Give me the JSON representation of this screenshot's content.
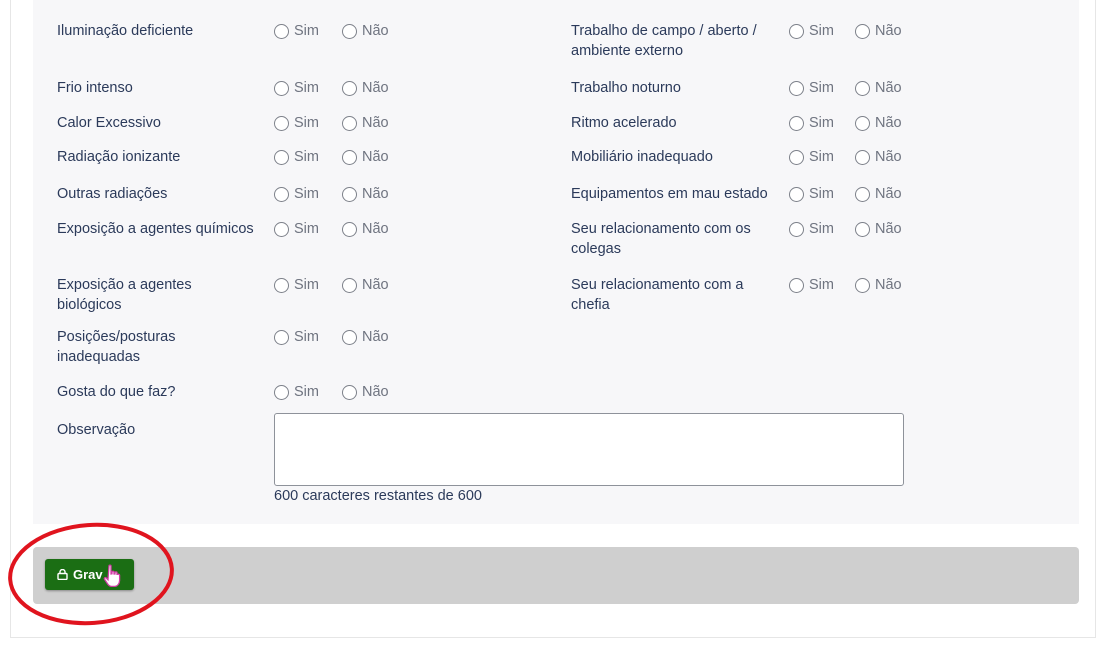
{
  "options": {
    "yes": "Sim",
    "no": "Não"
  },
  "left_questions": [
    {
      "label": "Iluminação deficiente"
    },
    {
      "label": "Frio intenso"
    },
    {
      "label": "Calor Excessivo"
    },
    {
      "label": "Radiação ionizante"
    },
    {
      "label": "Outras radiações"
    },
    {
      "label": "Exposição a agentes químicos"
    },
    {
      "label": "Exposição a agentes biológicos"
    },
    {
      "label": "Posições/posturas inadequadas"
    },
    {
      "label": "Gosta do que faz?"
    }
  ],
  "right_questions": [
    {
      "label": "Trabalho de campo / aberto / ambiente externo"
    },
    {
      "label": "Trabalho noturno"
    },
    {
      "label": "Ritmo acelerado"
    },
    {
      "label": "Mobiliário inadequado"
    },
    {
      "label": "Equipamentos em mau estado"
    },
    {
      "label": "Seu relacionamento com os colegas"
    },
    {
      "label": "Seu relacionamento com a chefia"
    }
  ],
  "observation": {
    "label": "Observação",
    "value": "",
    "counter": "600 caracteres restantes de 600"
  },
  "footer": {
    "save_label": "Grav",
    "save_icon": "lock-icon"
  },
  "annotation": {
    "color": "#e0141e"
  }
}
